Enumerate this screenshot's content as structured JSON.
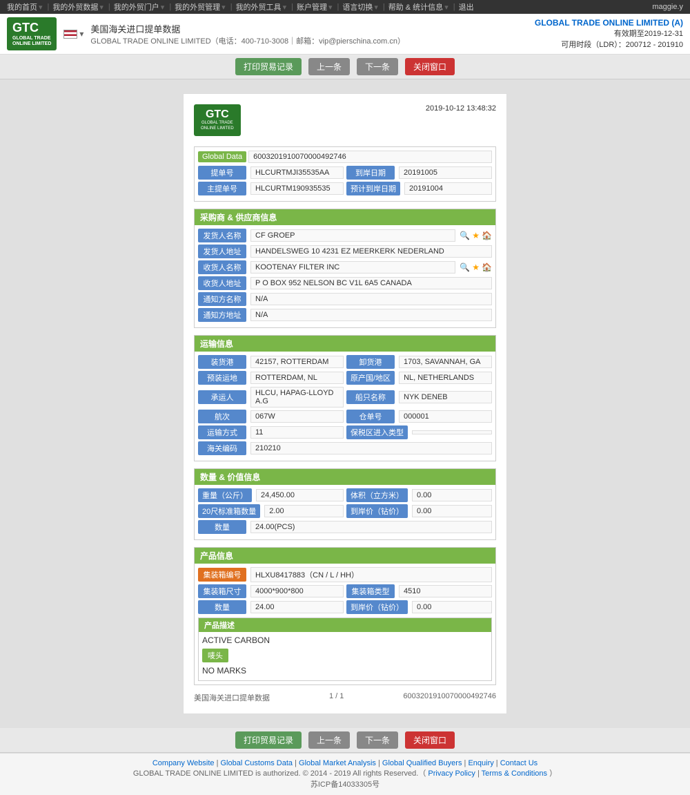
{
  "topbar": {
    "user": "maggie.y",
    "nav_items": [
      "我的首页",
      "我的外贸数据",
      "我的外贸门户",
      "我的外贸管理",
      "我的外贸工具",
      "账户管理",
      "语言切换",
      "帮助 & 统计信息",
      "退出"
    ]
  },
  "header": {
    "title": "美国海关进口提单数据",
    "company_line": "GLOBAL TRADE ONLINE LIMITED（电话：400-710-3008｜邮箱：vip@pierschina.com.cn）",
    "right_company": "GLOBAL TRADE ONLINE LIMITED (A)",
    "expire_label": "有效期至",
    "expire_date": "2019-12-31",
    "ldr_label": "可用时段（LDR）：200712 - 201910"
  },
  "action_bar": {
    "print_btn": "打印贸易记录",
    "prev_btn": "上一条",
    "next_btn": "下一条",
    "close_btn": "关闭窗口"
  },
  "document": {
    "logo_sub": "GLOBAL TRADE ONLINE LIMITED",
    "datetime": "2019-10-12  13:48:32",
    "global_data_label": "Global Data",
    "global_data_value": "6003201910070000492746",
    "bill_no_label": "提单号",
    "bill_no_value": "HLCURTMJI35535AA",
    "arrival_date_label": "到岸日期",
    "arrival_date_value": "20191005",
    "master_bill_label": "主提单号",
    "master_bill_value": "HLCURTM190935535",
    "estimated_arrival_label": "预计到岸日期",
    "estimated_arrival_value": "20191004",
    "supplier_section": "采购商 & 供应商信息",
    "shipper_label": "发货人名称",
    "shipper_value": "CF GROEP",
    "shipper_addr_label": "发货人地址",
    "shipper_addr_value": "HANDELSWEG 10 4231 EZ MEERKERK NEDERLAND",
    "consignee_label": "收货人名称",
    "consignee_value": "KOOTENAY FILTER INC",
    "consignee_addr_label": "收货人地址",
    "consignee_addr_value": "P O BOX 952 NELSON BC V1L 6A5 CANADA",
    "notify_name_label": "通知方名称",
    "notify_name_value": "N/A",
    "notify_addr_label": "通知方地址",
    "notify_addr_value": "N/A",
    "shipping_section": "运输信息",
    "origin_port_label": "装货港",
    "origin_port_value": "42157, ROTTERDAM",
    "dest_port_label": "卸货港",
    "dest_port_value": "1703, SAVANNAH, GA",
    "preload_label": "预装运地",
    "preload_value": "ROTTERDAM, NL",
    "origin_country_label": "原产国/地区",
    "origin_country_value": "NL, NETHERLANDS",
    "carrier_label": "承运人",
    "carrier_value": "HLCU, HAPAG-LLOYD A.G",
    "vessel_label": "船只名称",
    "vessel_value": "NYK DENEB",
    "voyage_label": "航次",
    "voyage_value": "067W",
    "warehouse_label": "仓单号",
    "warehouse_value": "000001",
    "transport_label": "运输方式",
    "transport_value": "11",
    "bonded_label": "保税区进入类型",
    "bonded_value": "",
    "customs_label": "海关编码",
    "customs_value": "210210",
    "qty_section": "数量 & 价值信息",
    "weight_label": "重量（公斤）",
    "weight_value": "24,450.00",
    "volume_label": "体积（立方米）",
    "volume_value": "0.00",
    "container20_label": "20尺标准箱数量",
    "container20_value": "2.00",
    "unit_price_label": "到岸价（钻价）",
    "unit_price_value": "0.00",
    "quantity_label": "数量",
    "quantity_value": "24.00(PCS)",
    "product_section": "产品信息",
    "container_no_label": "集装箱编号",
    "container_no_value": "HLXU8417883（CN / L / HH）",
    "container_size_label": "集装箱尺寸",
    "container_size_value": "4000*900*800",
    "container_type_label": "集装箱类型",
    "container_type_value": "4510",
    "product_qty_label": "数量",
    "product_qty_value": "24.00",
    "product_price_label": "到岸价（钻价）",
    "product_price_value": "0.00",
    "desc_section": "产品描述",
    "desc_value": "ACTIVE CARBON",
    "marks_label": "唛头",
    "marks_value": "NO MARKS",
    "footer_source": "美国海关进口提单数据",
    "footer_page": "1 / 1",
    "footer_id": "6003201910070000492746"
  },
  "site_footer": {
    "links": [
      "Company Website",
      "Global Customs Data",
      "Global Market Analysis",
      "Global Qualified Buyers",
      "Enquiry",
      "Contact Us"
    ],
    "copyright": "GLOBAL TRADE ONLINE LIMITED is authorized. © 2014 - 2019 All rights Reserved.（",
    "privacy": "Privacy Policy",
    "separator": "|",
    "terms": "Terms & Conditions",
    "copyright_end": "）",
    "icp": "苏ICP备14033305号"
  }
}
